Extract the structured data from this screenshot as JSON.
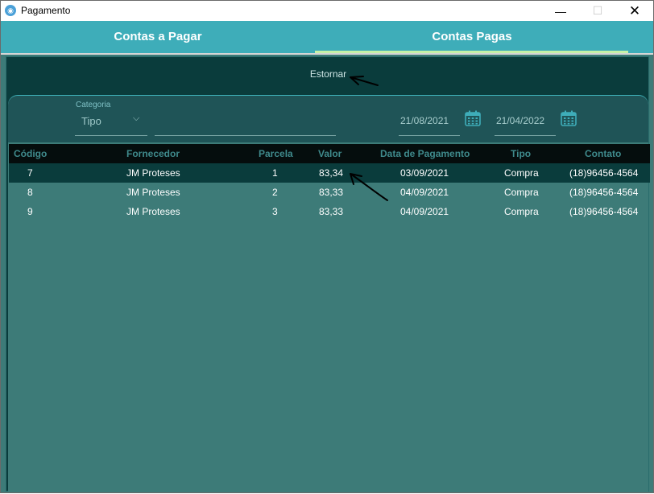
{
  "window": {
    "title": "Pagamento",
    "minimize": "—",
    "maximize": "☐",
    "close": "✕",
    "app_icon_glyph": "◉"
  },
  "tabs": [
    {
      "label": "Contas a Pagar",
      "active": false
    },
    {
      "label": "Contas Pagas",
      "active": true
    }
  ],
  "actions": {
    "estornar_label": "Estornar"
  },
  "filters": {
    "category_label": "Categoria",
    "category_value": "Tipo",
    "search_value": "",
    "date_start": "21/08/2021",
    "date_end": "21/04/2022"
  },
  "table": {
    "columns": [
      "Código",
      "Fornecedor",
      "Parcela",
      "Valor",
      "Data de Pagamento",
      "Tipo",
      "Contato"
    ],
    "rows": [
      {
        "codigo": "7",
        "fornecedor": "JM Proteses",
        "parcela": "1",
        "valor": "83,34",
        "data": "03/09/2021",
        "tipo": "Compra",
        "contato": "(18)96456-4564",
        "selected": true
      },
      {
        "codigo": "8",
        "fornecedor": "JM Proteses",
        "parcela": "2",
        "valor": "83,33",
        "data": "04/09/2021",
        "tipo": "Compra",
        "contato": "(18)96456-4564",
        "selected": false
      },
      {
        "codigo": "9",
        "fornecedor": "JM Proteses",
        "parcela": "3",
        "valor": "83,33",
        "data": "04/09/2021",
        "tipo": "Compra",
        "contato": "(18)96456-4564",
        "selected": false
      }
    ]
  },
  "colors": {
    "tab_bar": "#3eadb9",
    "panel_dark": "#0a3c3c",
    "panel_body": "#3d7b78",
    "header_bg": "#050d0d",
    "header_text": "#3f8a8c",
    "calendar_icon": "#3eadb9"
  },
  "icons": [
    "app-logo-icon",
    "chevron-down-icon",
    "calendar-icon"
  ]
}
